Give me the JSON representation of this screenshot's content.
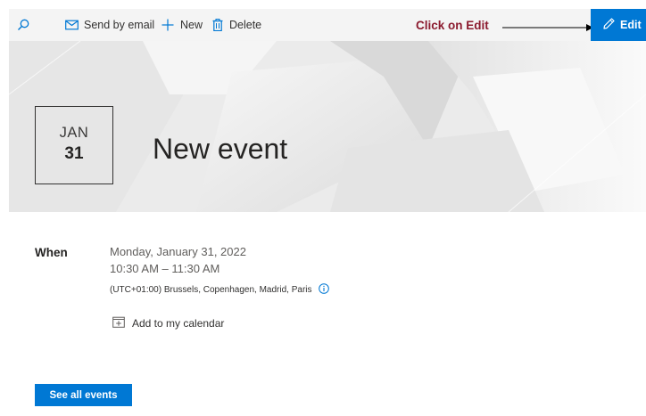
{
  "toolbar": {
    "search_icon": "search-icon",
    "send_email_label": "Send by email",
    "new_label": "New",
    "delete_label": "Delete",
    "edit_label": "Edit"
  },
  "annotation": {
    "text": "Click on Edit",
    "color": "#8b1a2e"
  },
  "event": {
    "month": "JAN",
    "day": "31",
    "title": "New event"
  },
  "details": {
    "when_label": "When",
    "date": "Monday, January 31, 2022",
    "time": "10:30 AM – 11:30 AM",
    "timezone": "(UTC+01:00) Brussels, Copenhagen, Madrid, Paris",
    "add_to_calendar": "Add to my calendar"
  },
  "footer": {
    "see_all_label": "See all events"
  },
  "colors": {
    "accent": "#0078d4",
    "command_bar": "#f4f4f4",
    "banner": "#ececec"
  }
}
